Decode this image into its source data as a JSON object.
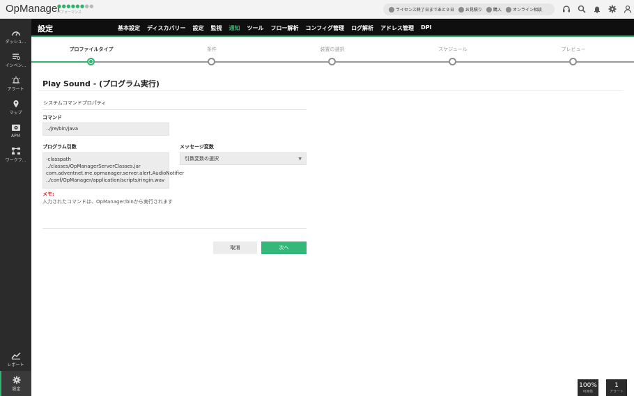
{
  "app": {
    "logo": "OpManager",
    "stars_filled": "●●●●●●",
    "stars_empty": "●●",
    "performance_label": "パフォーマンス"
  },
  "topbar": {
    "license": "ライセンス終了日まであと９日",
    "quote": "お見積り",
    "buy": "購入",
    "consult": "オンライン相談"
  },
  "sidebar": {
    "items": [
      {
        "label": "ダッシュ...",
        "icon": "dashboard-icon"
      },
      {
        "label": "インベン...",
        "icon": "inventory-icon"
      },
      {
        "label": "アラート",
        "icon": "alert-icon"
      },
      {
        "label": "マップ",
        "icon": "map-pin-icon"
      },
      {
        "label": "APM",
        "icon": "apm-icon"
      },
      {
        "label": "ワークフ...",
        "icon": "workflow-icon"
      },
      {
        "label": "レポート",
        "icon": "report-icon"
      },
      {
        "label": "設定",
        "icon": "settings-icon"
      }
    ]
  },
  "header": {
    "title": "設定",
    "nav": [
      "基本設定",
      "ディスカバリー",
      "設定",
      "監視",
      "通知",
      "ツール",
      "フロー解析",
      "コンフィグ管理",
      "ログ解析",
      "アドレス管理",
      "DPI"
    ],
    "active_nav": "通知"
  },
  "stepper": {
    "steps": [
      "プロファイルタイプ",
      "条件",
      "装置の選択",
      "スケジュール",
      "プレビュー"
    ],
    "active_index": 0
  },
  "form": {
    "title": "Play Sound - (プログラム実行)",
    "section": "システムコマンドプロパティ",
    "command_label": "コマンド",
    "command_value": "../jre/bin/java",
    "args_label": "プログラム引数",
    "args_value": "-classpath ../classes/OpManagerServerClasses.jar com.adventnet.me.opmanager.server.alert.AudioNotifier ../conf/OpManager/application/scripts/ringin.wav",
    "msgvar_label": "メッセージ変数",
    "msgvar_value": "引数変数の選択",
    "memo_label": "メモ:",
    "memo_text": "入力されたコマンドは、OpManager/binから実行されます",
    "cancel": "取消",
    "next": "次へ"
  },
  "widgets": {
    "availability_value": "100%",
    "availability_label": "可用性",
    "alerts_value": "1",
    "alerts_label": "アラート"
  },
  "colors": {
    "accent": "#2fb36d",
    "header_bg": "#0f0f0f",
    "sidebar_bg": "#2b2b2b",
    "memo": "#d62020"
  }
}
